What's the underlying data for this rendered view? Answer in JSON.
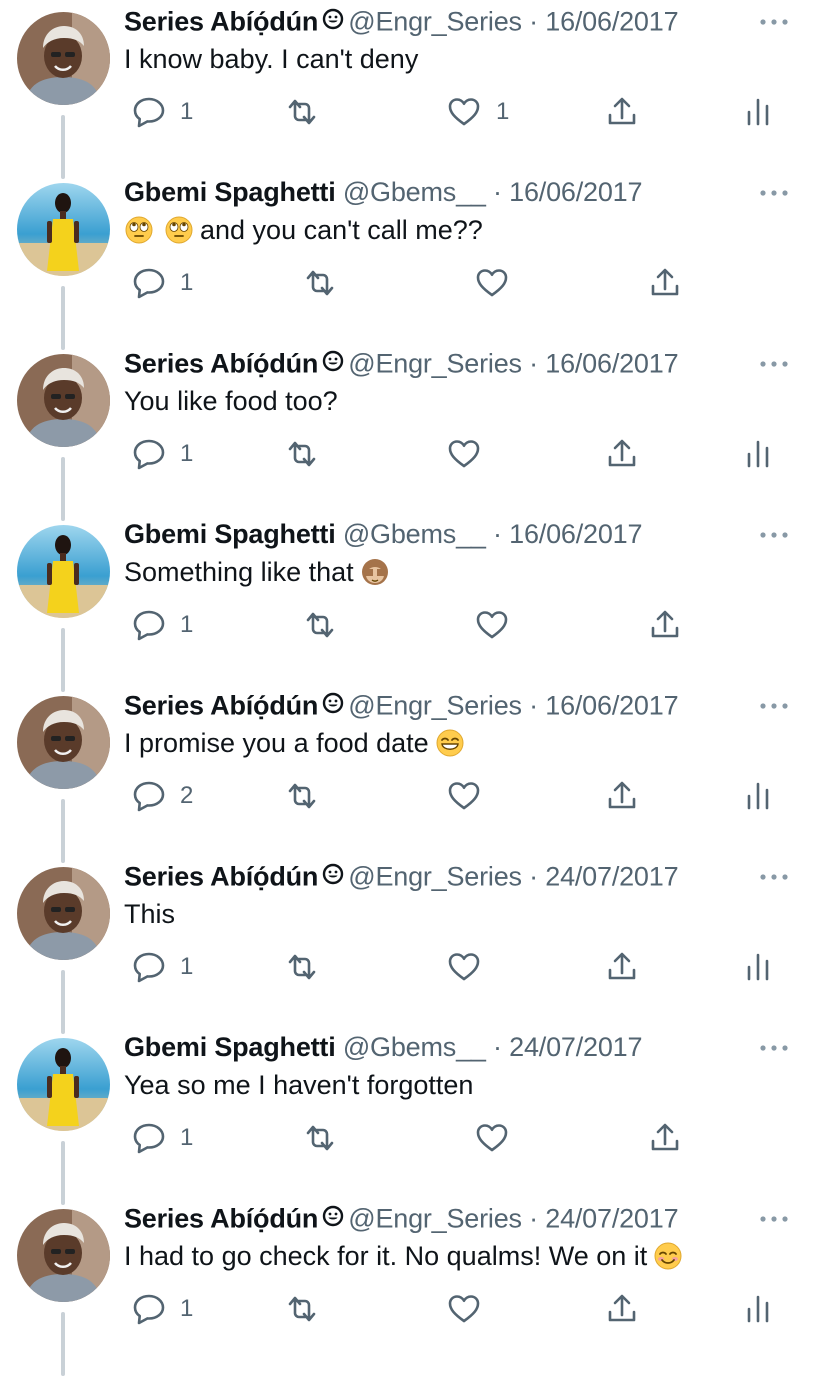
{
  "users": {
    "series": {
      "name": "Series Abíọ́dún",
      "handle": "@Engr_Series",
      "avatar_icon": "person-avatar-white-hair",
      "verified": true
    },
    "gbemi": {
      "name": "Gbemi Spaghetti",
      "handle": "@Gbems__",
      "avatar_icon": "person-avatar-yellow-dress-beach",
      "verified": false
    }
  },
  "separator": "·",
  "tweets": [
    {
      "user": "series",
      "name": "Series Abíọ́dún",
      "handle": "@Engr_Series",
      "date": "16/06/2017",
      "text": "I know baby.  I can't deny",
      "emoji_prefix": [],
      "emoji_suffix": [],
      "replies": "1",
      "likes": "1",
      "show_analytics": true
    },
    {
      "user": "gbemi",
      "name": "Gbemi Spaghetti",
      "handle": "@Gbems__",
      "date": "16/06/2017",
      "text": "and you can't call me??",
      "emoji_prefix": [
        "face-with-rolling-eyes",
        "face-with-rolling-eyes"
      ],
      "emoji_suffix": [],
      "replies": "1",
      "likes": "",
      "show_analytics": false
    },
    {
      "user": "series",
      "name": "Series Abíọ́dún",
      "handle": "@Engr_Series",
      "date": "16/06/2017",
      "text": "You like food too?",
      "emoji_prefix": [],
      "emoji_suffix": [],
      "replies": "1",
      "likes": "",
      "show_analytics": true
    },
    {
      "user": "gbemi",
      "name": "Gbemi Spaghetti",
      "handle": "@Gbems__",
      "date": "16/06/2017",
      "text": "Something like that",
      "emoji_prefix": [],
      "emoji_suffix": [
        "see-no-evil-monkey"
      ],
      "replies": "1",
      "likes": "",
      "show_analytics": false
    },
    {
      "user": "series",
      "name": "Series Abíọ́dún",
      "handle": "@Engr_Series",
      "date": "16/06/2017",
      "text": "I promise you a food date",
      "emoji_prefix": [],
      "emoji_suffix": [
        "grinning-face-with-smiling-eyes"
      ],
      "replies": "2",
      "likes": "",
      "show_analytics": true
    },
    {
      "user": "series",
      "name": "Series Abíọ́dún",
      "handle": "@Engr_Series",
      "date": "24/07/2017",
      "text": "This",
      "emoji_prefix": [],
      "emoji_suffix": [],
      "replies": "1",
      "likes": "",
      "show_analytics": true
    },
    {
      "user": "gbemi",
      "name": "Gbemi Spaghetti",
      "handle": "@Gbems__",
      "date": "24/07/2017",
      "text": "Yea so me I haven't forgotten",
      "emoji_prefix": [],
      "emoji_suffix": [],
      "replies": "1",
      "likes": "",
      "show_analytics": false
    },
    {
      "user": "series",
      "name": "Series Abíọ́dún",
      "handle": "@Engr_Series",
      "date": "24/07/2017",
      "text": "I had to go check for it. No qualms! We on it",
      "emoji_prefix": [],
      "emoji_suffix": [
        "smiling-face-with-smiling-eyes"
      ],
      "replies": "1",
      "likes": "",
      "show_analytics": true
    }
  ],
  "colors": {
    "text": "#0f1419",
    "secondary": "#536471",
    "thread_line": "#c9d1d7",
    "background": "#ffffff"
  }
}
